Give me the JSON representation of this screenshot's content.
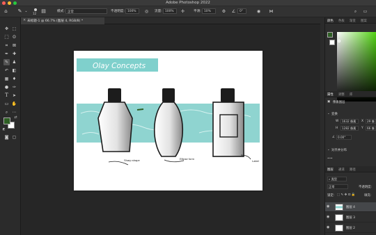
{
  "colors": {
    "foreground": "#2e5f24",
    "background": "#ffffff",
    "accent": "#7fd0cc"
  },
  "window": {
    "title": "Adobe Photoshop 2022"
  },
  "options_bar": {
    "mode_label": "模式:",
    "mode_value": "正常",
    "opacity_label": "不透明度:",
    "opacity_value": "100%",
    "flow_label": "流量:",
    "flow_value": "100%",
    "smoothing_label": "平滑:",
    "smoothing_value": "10%",
    "angle_value": "0°",
    "brush_size": "12"
  },
  "document_tab": {
    "label": "未标题-1 @ 66.7% (图层 4, RGB/8) *"
  },
  "artwork": {
    "banner_title": "Olay Concepts",
    "captions": [
      "Sharp shape",
      "Ellipse form",
      "Label"
    ]
  },
  "panels": {
    "color_tabs": [
      "颜色",
      "色板",
      "渐变",
      "图案"
    ],
    "properties_tabs": [
      "属性",
      "调整",
      "库"
    ],
    "properties": {
      "layer_kind": "像素图层",
      "transform_label": "变换",
      "w_label": "W",
      "w_value": "1632 像素",
      "x_label": "X",
      "x_value": "29 像",
      "h_label": "H",
      "h_value": "1282 像素",
      "y_label": "Y",
      "y_value": "66 像",
      "angle_value": "0.00°",
      "align_label": "对齐并分布"
    },
    "layers_tabs": [
      "图层",
      "通道",
      "路径"
    ],
    "layers": {
      "filter_kind": "类型",
      "blend_mode": "正常",
      "opacity_label": "不透明度:",
      "lock_label": "锁定:",
      "fill_label": "填充:",
      "items": [
        {
          "name": "图层 4",
          "selected": true
        },
        {
          "name": "图层 3",
          "selected": false
        },
        {
          "name": "图层 2",
          "selected": false
        }
      ]
    }
  }
}
